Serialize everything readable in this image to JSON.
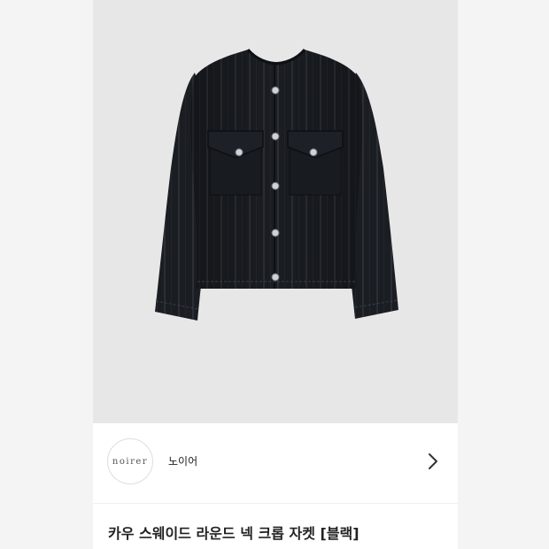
{
  "product": {
    "image_alt": "black suede round neck cropped jacket",
    "image_background": "#e7e7e7"
  },
  "brand": {
    "logo_text": "noirer",
    "name": "노이어",
    "chevron_icon": "chevron-right-icon"
  },
  "title": "카우 스웨이드 라운드 넥 크롭 자켓 [블랙]"
}
